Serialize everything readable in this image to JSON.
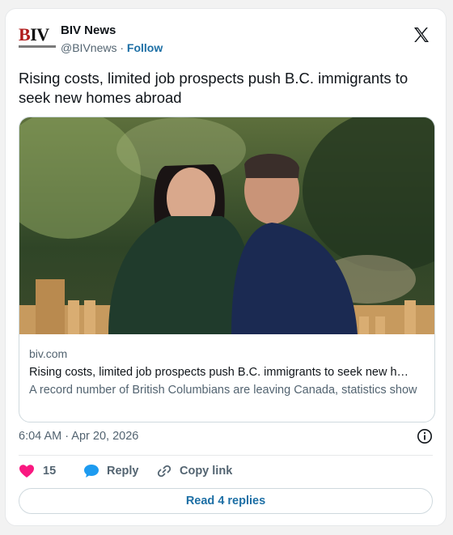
{
  "account": {
    "logo_text_b": "B",
    "logo_text_iv": "IV",
    "name": "BIV News",
    "handle": "@BIVnews",
    "separator": "·",
    "follow_label": "Follow"
  },
  "tweet": {
    "text": "Rising costs, limited job prospects push B.C. immigrants to seek new homes abroad"
  },
  "link_card": {
    "domain": "biv.com",
    "title": "Rising costs, limited job prospects push B.C. immigrants to seek new h…",
    "description": "A record number of British Columbians are leaving Canada, statistics show",
    "image_alt": "Smiling couple standing in front of a wooden fence and evergreen trees"
  },
  "meta": {
    "timestamp": "6:04 AM · Apr 20, 2026"
  },
  "actions": {
    "like_count": "15",
    "reply_label": "Reply",
    "copy_label": "Copy link"
  },
  "footer": {
    "read_replies_label": "Read 4 replies"
  },
  "colors": {
    "accent": "#1d6fa5",
    "like": "#f91880",
    "reply": "#1d9bf0",
    "muted": "#536471"
  },
  "icons": {
    "x_logo": "x-logo-icon",
    "info": "info-icon",
    "heart": "heart-icon",
    "reply": "reply-bubble-icon",
    "link": "link-icon"
  }
}
